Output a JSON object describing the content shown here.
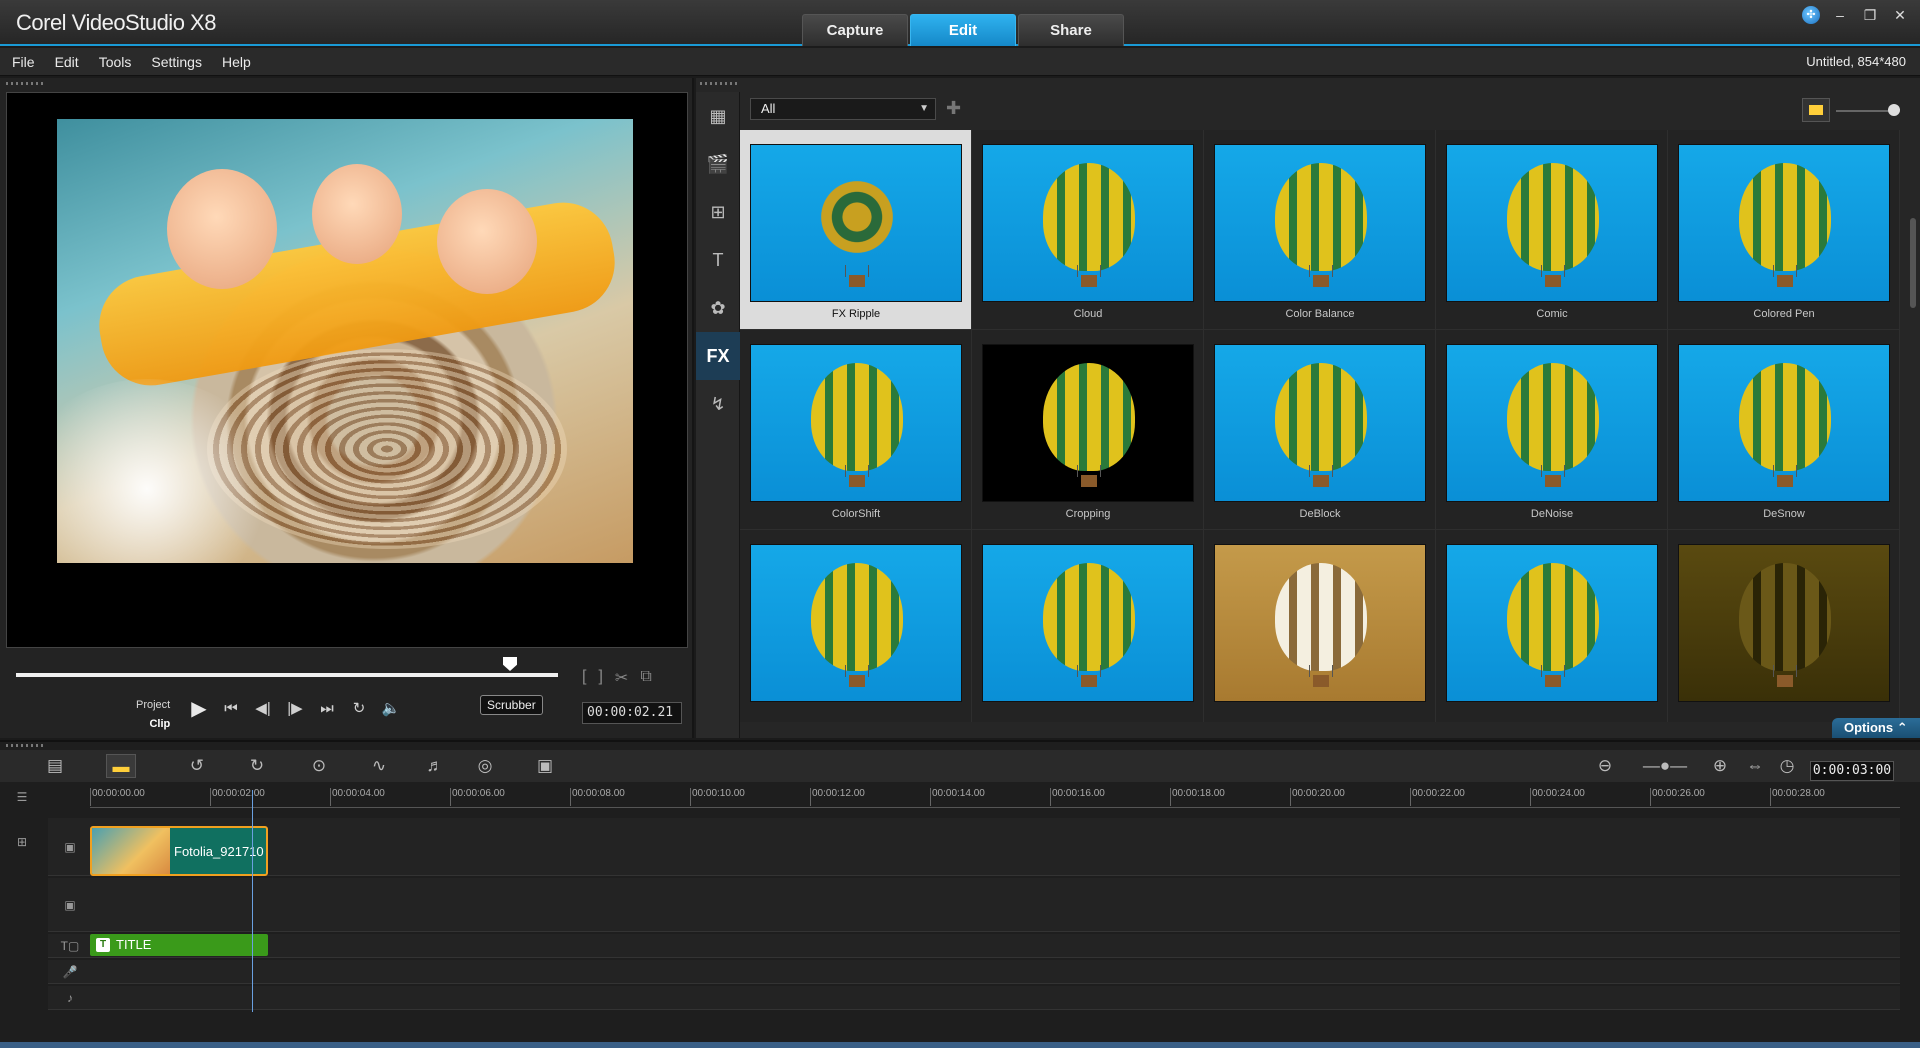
{
  "window": {
    "title": "Corel VideoStudio X8",
    "mode_tabs": [
      {
        "label": "Capture",
        "active": false
      },
      {
        "label": "Edit",
        "active": true
      },
      {
        "label": "Share",
        "active": false
      }
    ],
    "controls": [
      "globe-icon",
      "minimize-icon",
      "restore-icon",
      "close-icon"
    ],
    "accent_color": "#1a9ad6"
  },
  "menu": {
    "items": [
      "File",
      "Edit",
      "Tools",
      "Settings",
      "Help"
    ],
    "project_info": "Untitled, 854*480"
  },
  "player": {
    "mode_labels": {
      "project": "Project",
      "clip": "Clip"
    },
    "tooltip": "Scrubber",
    "timecode": "00:00:02.21",
    "scrubber_position": 0.93
  },
  "library": {
    "filter": "All",
    "sidebar": [
      "media-icon",
      "instant-project-icon",
      "transition-icon",
      "title-icon",
      "graphic-icon",
      "fx-icon",
      "path-icon"
    ],
    "sidebar_fx_label": "FX",
    "effects": [
      {
        "label": "FX Ripple",
        "selected": true
      },
      {
        "label": "Cloud",
        "selected": false
      },
      {
        "label": "Color Balance",
        "selected": false
      },
      {
        "label": "Comic",
        "selected": false
      },
      {
        "label": "Colored Pen",
        "selected": false
      },
      {
        "label": "ColorShift",
        "selected": false
      },
      {
        "label": "Cropping",
        "selected": false
      },
      {
        "label": "DeBlock",
        "selected": false
      },
      {
        "label": "DeNoise",
        "selected": false
      },
      {
        "label": "DeSnow",
        "selected": false
      },
      {
        "label": "",
        "selected": false
      },
      {
        "label": "",
        "selected": false
      },
      {
        "label": "",
        "selected": false
      },
      {
        "label": "",
        "selected": false
      },
      {
        "label": "",
        "selected": false
      }
    ],
    "options_label": "Options"
  },
  "timeline": {
    "timecode": "0:00:03:00",
    "ruler_ticks": [
      "00:00:00.00",
      "00:00:02.00",
      "00:00:04.00",
      "00:00:06.00",
      "00:00:08.00",
      "00:00:10.00",
      "00:00:12.00",
      "00:00:14.00",
      "00:00:16.00",
      "00:00:18.00",
      "00:00:20.00",
      "00:00:22.00",
      "00:00:24.00",
      "00:00:26.00",
      "00:00:28.00"
    ],
    "video_clip": "Fotolia_921710",
    "title_clip": "TITLE",
    "title_badge": "T"
  }
}
